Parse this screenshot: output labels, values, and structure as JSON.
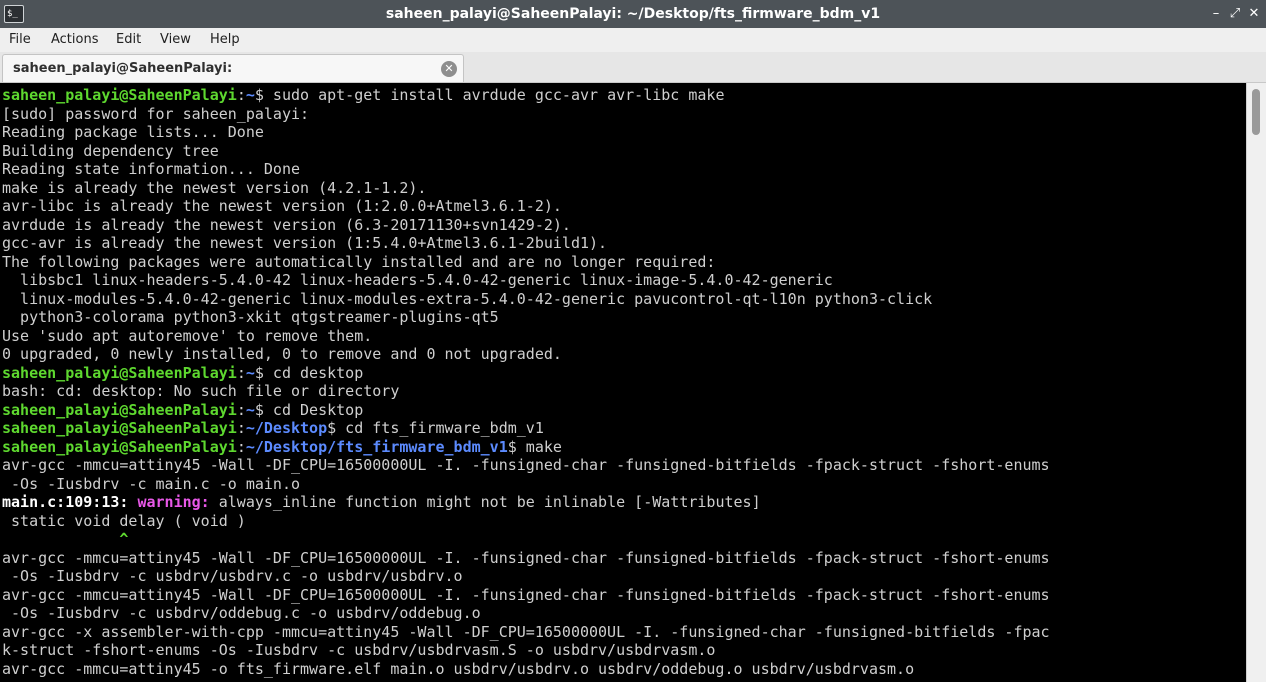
{
  "window": {
    "title": "saheen_palayi@SaheenPalayi: ~/Desktop/fts_firmware_bdm_v1",
    "app_icon_text": "$_",
    "controls": {
      "minimize": "–",
      "maximize": "⤢",
      "close": "✕"
    }
  },
  "menu": {
    "items": [
      "File",
      "Actions",
      "Edit",
      "View",
      "Help"
    ]
  },
  "tab": {
    "label": "saheen_palayi@SaheenPalayi: ~/Desktop/fts_firmware_bdm_v1",
    "close": "✕"
  },
  "terminal": {
    "prompt_user": "saheen_palayi@SaheenPalayi",
    "lines": [
      {
        "type": "prompt",
        "path": "~",
        "cmd": " sudo apt-get install avrdude gcc-avr avr-libc make"
      },
      {
        "type": "out",
        "text": "[sudo] password for saheen_palayi:"
      },
      {
        "type": "out",
        "text": "Reading package lists... Done"
      },
      {
        "type": "out",
        "text": "Building dependency tree"
      },
      {
        "type": "out",
        "text": "Reading state information... Done"
      },
      {
        "type": "out",
        "text": "make is already the newest version (4.2.1-1.2)."
      },
      {
        "type": "out",
        "text": "avr-libc is already the newest version (1:2.0.0+Atmel3.6.1-2)."
      },
      {
        "type": "out",
        "text": "avrdude is already the newest version (6.3-20171130+svn1429-2)."
      },
      {
        "type": "out",
        "text": "gcc-avr is already the newest version (1:5.4.0+Atmel3.6.1-2build1)."
      },
      {
        "type": "out",
        "text": "The following packages were automatically installed and are no longer required:"
      },
      {
        "type": "out",
        "text": "  libsbc1 linux-headers-5.4.0-42 linux-headers-5.4.0-42-generic linux-image-5.4.0-42-generic"
      },
      {
        "type": "out",
        "text": "  linux-modules-5.4.0-42-generic linux-modules-extra-5.4.0-42-generic pavucontrol-qt-l10n python3-click"
      },
      {
        "type": "out",
        "text": "  python3-colorama python3-xkit qtgstreamer-plugins-qt5"
      },
      {
        "type": "out",
        "text": "Use 'sudo apt autoremove' to remove them."
      },
      {
        "type": "out",
        "text": "0 upgraded, 0 newly installed, 0 to remove and 0 not upgraded."
      },
      {
        "type": "prompt",
        "path": "~",
        "cmd": " cd desktop"
      },
      {
        "type": "out",
        "text": "bash: cd: desktop: No such file or directory"
      },
      {
        "type": "prompt",
        "path": "~",
        "cmd": " cd Desktop"
      },
      {
        "type": "prompt",
        "path": "~/Desktop",
        "cmd": " cd fts_firmware_bdm_v1"
      },
      {
        "type": "prompt",
        "path": "~/Desktop/fts_firmware_bdm_v1",
        "cmd": " make"
      },
      {
        "type": "out",
        "text": "avr-gcc -mmcu=attiny45 -Wall -DF_CPU=16500000UL -I. -funsigned-char -funsigned-bitfields -fpack-struct -fshort-enums"
      },
      {
        "type": "out",
        "text": " -Os -Iusbdrv -c main.c -o main.o"
      },
      {
        "type": "warning",
        "loc": "main.c:109:13:",
        "label": "warning:",
        "msg": " always_inline function might not be inlinable [-Wattributes]"
      },
      {
        "type": "out",
        "text": " static void delay ( void )"
      },
      {
        "type": "caret",
        "text": "             ^"
      },
      {
        "type": "out",
        "text": "avr-gcc -mmcu=attiny45 -Wall -DF_CPU=16500000UL -I. -funsigned-char -funsigned-bitfields -fpack-struct -fshort-enums"
      },
      {
        "type": "out",
        "text": " -Os -Iusbdrv -c usbdrv/usbdrv.c -o usbdrv/usbdrv.o"
      },
      {
        "type": "out",
        "text": "avr-gcc -mmcu=attiny45 -Wall -DF_CPU=16500000UL -I. -funsigned-char -funsigned-bitfields -fpack-struct -fshort-enums"
      },
      {
        "type": "out",
        "text": " -Os -Iusbdrv -c usbdrv/oddebug.c -o usbdrv/oddebug.o"
      },
      {
        "type": "out",
        "text": "avr-gcc -x assembler-with-cpp -mmcu=attiny45 -Wall -DF_CPU=16500000UL -I. -funsigned-char -funsigned-bitfields -fpac"
      },
      {
        "type": "out",
        "text": "k-struct -fshort-enums -Os -Iusbdrv -c usbdrv/usbdrvasm.S -o usbdrv/usbdrvasm.o"
      },
      {
        "type": "out",
        "text": "avr-gcc -mmcu=attiny45 -o fts_firmware.elf main.o usbdrv/usbdrv.o usbdrv/oddebug.o usbdrv/usbdrvasm.o"
      }
    ]
  },
  "colors": {
    "prompt_user": "#5ed82f",
    "prompt_path": "#5c8bff",
    "warning": "#e858e8",
    "terminal_bg": "#000000",
    "titlebar_bg": "#4d5358"
  }
}
